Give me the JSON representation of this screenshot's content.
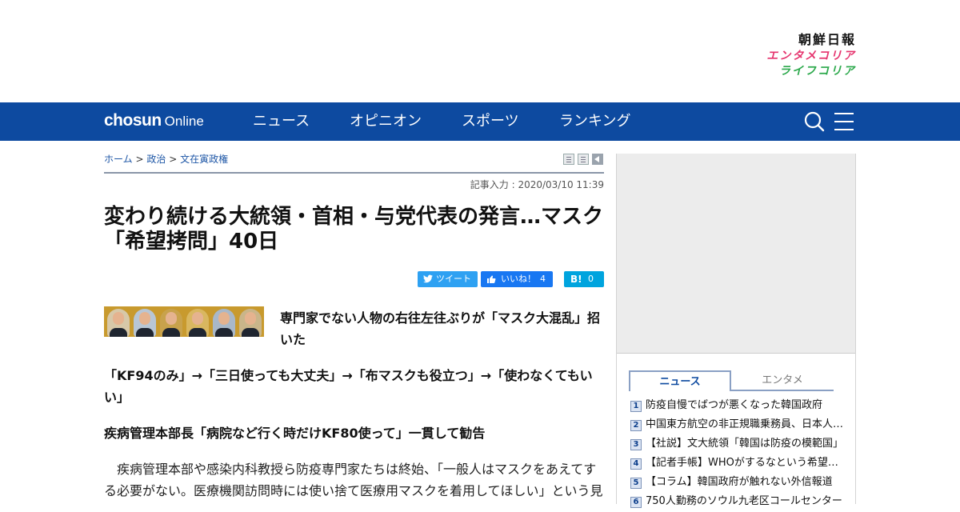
{
  "brand_links": {
    "main": "朝鮮日報",
    "enta": "エンタメコリア",
    "life": "ライフコリア"
  },
  "nav": {
    "logo_main": "chosun",
    "logo_sub": "Online",
    "items": [
      "ニュース",
      "オピニオン",
      "スポーツ",
      "ランキング"
    ],
    "icons": [
      "search-icon",
      "menu-icon"
    ]
  },
  "breadcrumb": {
    "items": [
      "ホーム",
      "政治",
      "文在寅政権"
    ],
    "separator": ">"
  },
  "article": {
    "dateline": "記事入力 : 2020/03/10 11:39",
    "title": "変わり続ける大統領・首相・与党代表の発言…マスク「希望拷問」40日",
    "share": {
      "tweet_label": "ツイート",
      "like_label": "いいね！",
      "like_count": "4",
      "hatena_label": "B!",
      "hatena_count": "0"
    },
    "subheads": [
      "専門家でない人物の右往左往ぶりが「マスク大混乱」招いた",
      "「KF94のみ」→「三日使っても大丈夫」→「布マスクも役立つ」→「使わなくてもいい」",
      "疾病管理本部長「病院など行く時だけKF80使って」一貫して勧告"
    ],
    "body": "疾病管理本部や感染内科教授ら防疫専門家たちは終始、「一般人はマスクをあえてする必要がない。医療機関訪問時には使い捨て医療用マスクを着用してほしい」という見"
  },
  "sidebar": {
    "tabs": [
      "ニュース",
      "エンタメ"
    ],
    "ranking": [
      {
        "num": "1",
        "title": "防疫自慢でばつが悪くなった韓国政府"
      },
      {
        "num": "2",
        "title": "中国東方航空の非正規職乗務員、日本人の搭乗を拒否"
      },
      {
        "num": "3",
        "title": "【社説】文大統領「韓国は防疫の模範国」"
      },
      {
        "num": "4",
        "title": "【記者手帳】WHOがするなという希望の押し売り"
      },
      {
        "num": "5",
        "title": "【コラム】韓国政府が触れない外信報道"
      },
      {
        "num": "6",
        "title": "750人勤務のソウル九老区コールセンター"
      }
    ]
  },
  "colors": {
    "nav_bg": "#0d4aa0",
    "twitter": "#2ea1f2",
    "facebook": "#1877f2",
    "hatena": "#00a4de",
    "enta": "#e5336d",
    "life": "#2aa84a"
  }
}
